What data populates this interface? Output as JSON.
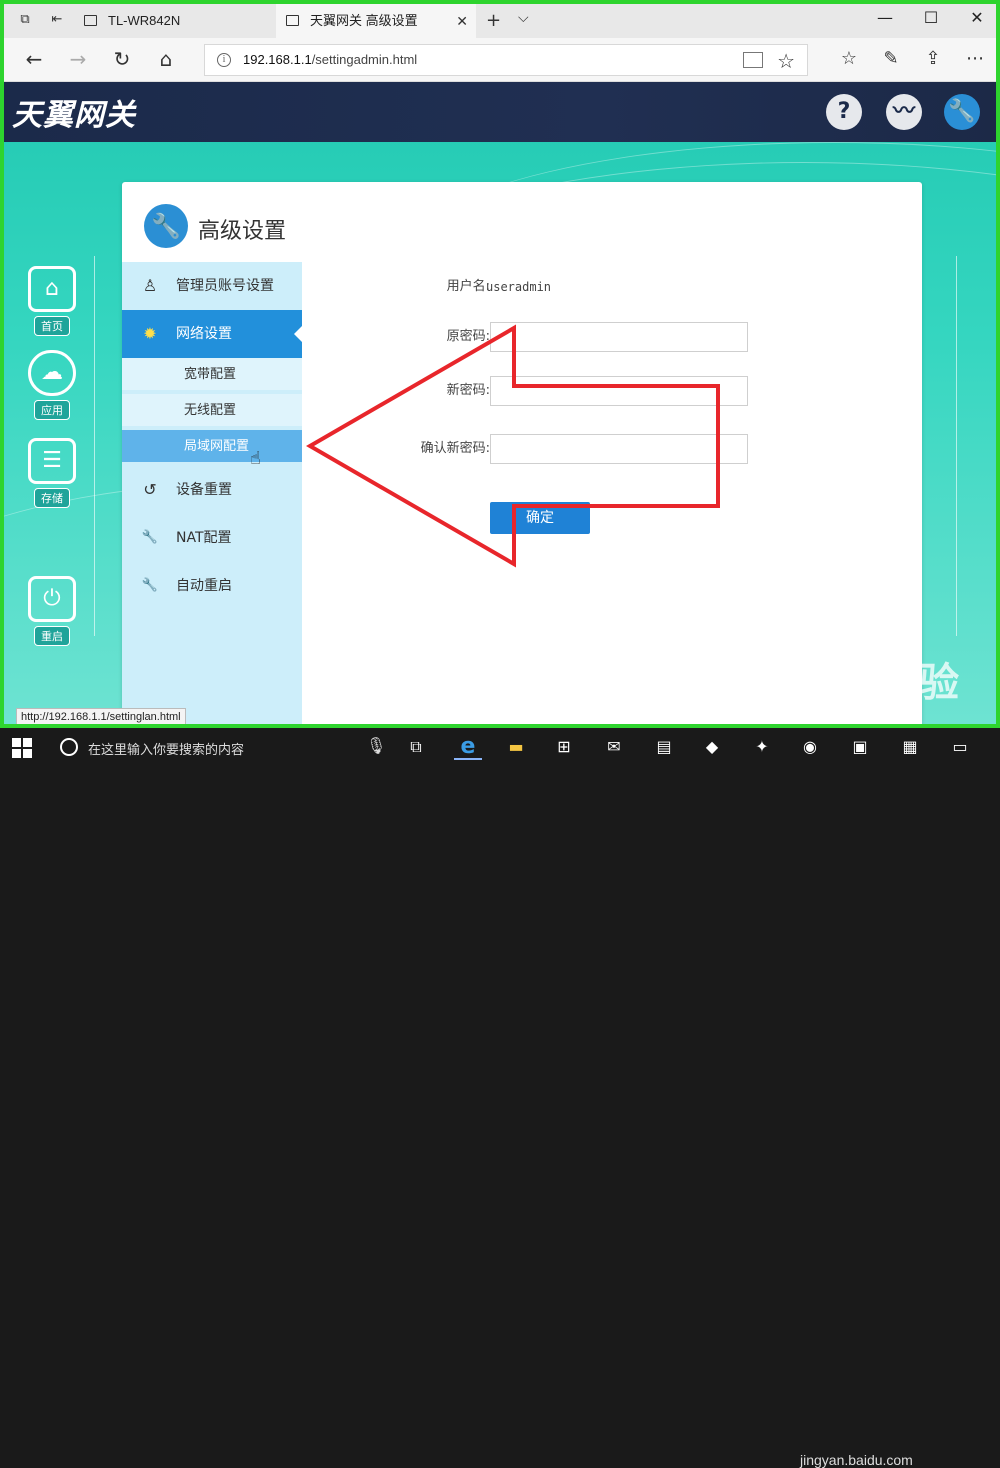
{
  "browser": {
    "tabs": [
      {
        "title": "TL-WR842N",
        "active": false
      },
      {
        "title": "天翼网关 高级设置",
        "active": true
      }
    ],
    "url_host": "192.168.1.1",
    "url_path": "/settingadmin.html",
    "status_url": "http://192.168.1.1/settinglan.html",
    "icons": [
      "back-icon",
      "forward-icon",
      "refresh-icon",
      "home-icon",
      "reading-view-icon",
      "favorite-star-icon",
      "favorites-list-icon",
      "pen-icon",
      "share-icon",
      "more-icon"
    ]
  },
  "header": {
    "logo": "天翼网关",
    "buttons": [
      {
        "name": "help",
        "glyph": "?"
      },
      {
        "name": "status",
        "glyph": "〰"
      },
      {
        "name": "settings",
        "glyph": "🔧"
      }
    ]
  },
  "left_nav": [
    {
      "label": "首页",
      "glyph": "⌂"
    },
    {
      "label": "应用",
      "glyph": "☁"
    },
    {
      "label": "存储",
      "glyph": "☰"
    },
    {
      "label": "重启",
      "glyph": "⏻"
    }
  ],
  "card": {
    "title": "高级设置",
    "sidebar": {
      "items": [
        {
          "label": "管理员账号设置",
          "glyph": "♙",
          "active": false
        },
        {
          "label": "网络设置",
          "glyph": "✹",
          "active": true
        },
        {
          "label": "设备重置",
          "glyph": "↺",
          "active": false
        },
        {
          "label": "NAT配置",
          "glyph": "🔧",
          "active": false
        },
        {
          "label": "自动重启",
          "glyph": "🔧",
          "active": false
        }
      ],
      "sub_items": [
        {
          "label": "宽带配置",
          "active": false
        },
        {
          "label": "无线配置",
          "active": false
        },
        {
          "label": "局域网配置",
          "active": true
        }
      ]
    },
    "form": {
      "username_label": "用户名:",
      "username_value": "useradmin",
      "old_password_label": "原密码:",
      "new_password_label": "新密码:",
      "confirm_password_label": "确认新密码:",
      "submit_label": "确定"
    }
  },
  "taskbar": {
    "search_placeholder": "在这里输入你要搜索的内容",
    "watermark": "Baidu经验",
    "watermark_sub": "jingyan.baidu.com"
  },
  "colors": {
    "frame_green": "#2ed42e",
    "header_navy": "#1b2a4a",
    "active_blue": "#2290db",
    "sidebar_bg": "#cdeefa",
    "page_teal": "#22c9b2",
    "annotation_red": "#e8262b"
  }
}
